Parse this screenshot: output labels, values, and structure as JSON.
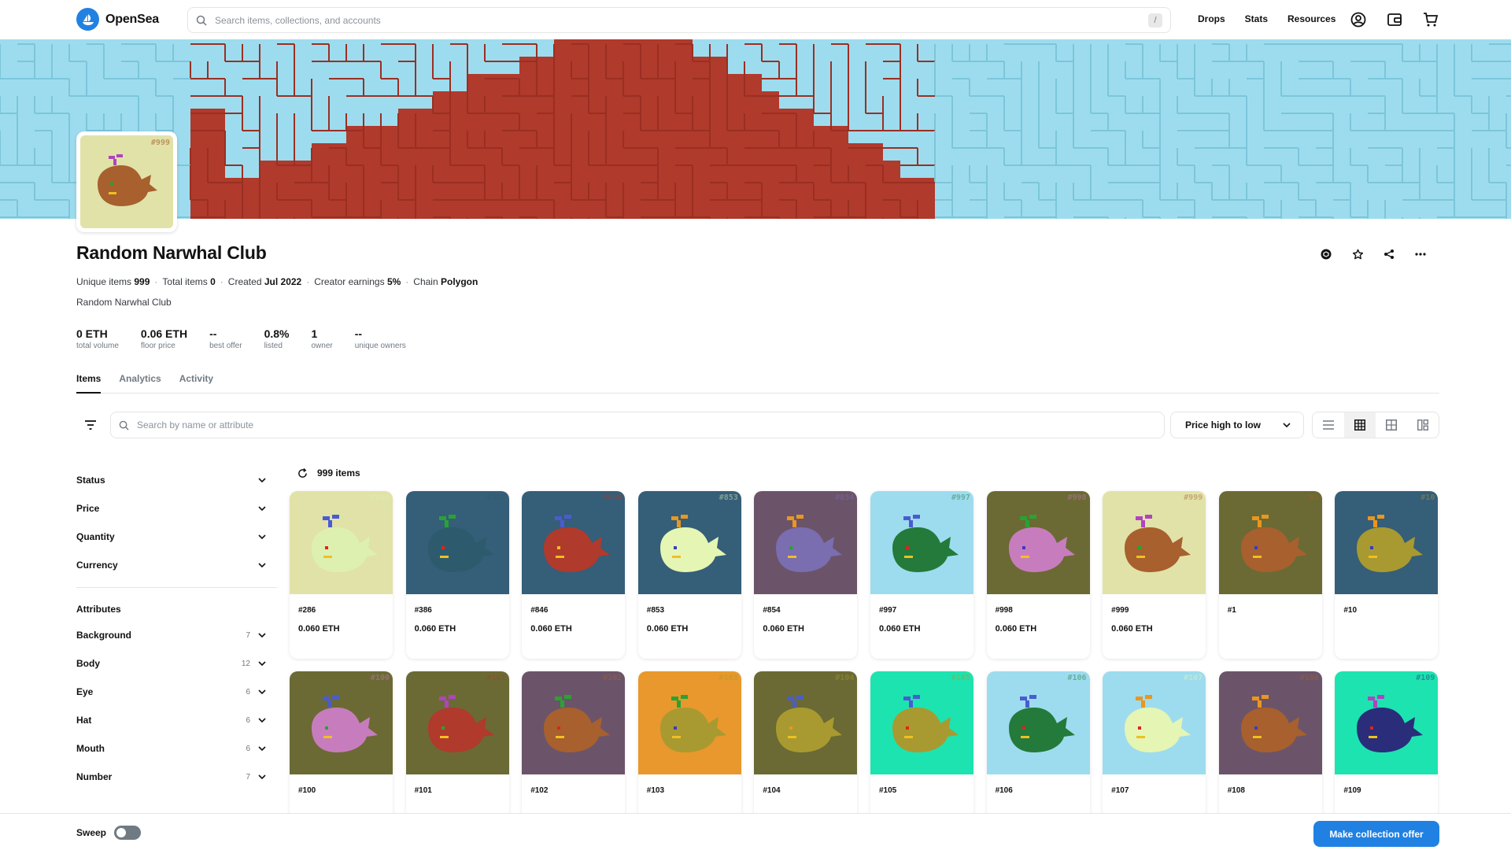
{
  "nav": {
    "brand": "OpenSea",
    "search_placeholder": "Search items, collections, and accounts",
    "search_shortcut": "/",
    "links": [
      "Drops",
      "Stats",
      "Resources"
    ]
  },
  "collection": {
    "title": "Random Narwhal Club",
    "meta": [
      {
        "label": "Unique items",
        "value": "999"
      },
      {
        "label": "Total items",
        "value": "0"
      },
      {
        "label": "Created",
        "value": "Jul 2022"
      },
      {
        "label": "Creator earnings",
        "value": "5%"
      },
      {
        "label": "Chain",
        "value": "Polygon"
      }
    ],
    "description": "Random Narwhal Club",
    "stats": [
      {
        "value": "0 ETH",
        "label": "total volume"
      },
      {
        "value": "0.06 ETH",
        "label": "floor price"
      },
      {
        "value": "--",
        "label": "best offer"
      },
      {
        "value": "0.8%",
        "label": "listed"
      },
      {
        "value": "1",
        "label": "owner"
      },
      {
        "value": "--",
        "label": "unique owners"
      }
    ]
  },
  "tabs": [
    "Items",
    "Analytics",
    "Activity"
  ],
  "toolbar": {
    "search_placeholder": "Search by name or attribute",
    "sort_label": "Price high to low"
  },
  "filters": {
    "groups": [
      "Status",
      "Price",
      "Quantity",
      "Currency"
    ],
    "attributes_title": "Attributes",
    "attributes": [
      {
        "name": "Background",
        "count": "7"
      },
      {
        "name": "Body",
        "count": "12"
      },
      {
        "name": "Eye",
        "count": "6"
      },
      {
        "name": "Hat",
        "count": "6"
      },
      {
        "name": "Mouth",
        "count": "6"
      },
      {
        "name": "Number",
        "count": "7"
      }
    ]
  },
  "results": {
    "count_label": "999 items"
  },
  "items": [
    {
      "name": "#286",
      "badge": "#286",
      "price": "0.060 ETH",
      "bg": "#e1e2a8",
      "body": "#ddf0b0",
      "hat": "#4a5bd1",
      "eye": "#e0241c"
    },
    {
      "name": "#386",
      "badge": "#386",
      "price": "0.060 ETH",
      "bg": "#355e78",
      "body": "#2d5b6d",
      "hat": "#28a332",
      "eye": "#e0241c"
    },
    {
      "name": "#846",
      "badge": "#846",
      "price": "0.060 ETH",
      "bg": "#355e78",
      "body": "#b03a2c",
      "hat": "#4a5bd1",
      "eye": "#f0c020"
    },
    {
      "name": "#853",
      "badge": "#853",
      "price": "0.060 ETH",
      "bg": "#355e78",
      "body": "#e5f5b3",
      "hat": "#e89720",
      "eye": "#3c3ac0"
    },
    {
      "name": "#854",
      "badge": "#854",
      "price": "0.060 ETH",
      "bg": "#6b5469",
      "body": "#7a6db0",
      "hat": "#e89720",
      "eye": "#28a332"
    },
    {
      "name": "#997",
      "badge": "#997",
      "price": "0.060 ETH",
      "bg": "#9ddcee",
      "body": "#237a3a",
      "hat": "#4a5bd1",
      "eye": "#e0241c"
    },
    {
      "name": "#998",
      "badge": "#998",
      "price": "0.060 ETH",
      "bg": "#6b6a34",
      "body": "#c77dbd",
      "hat": "#28a332",
      "eye": "#3c3ac0"
    },
    {
      "name": "#999",
      "badge": "#999",
      "price": "0.060 ETH",
      "bg": "#e1e2a8",
      "body": "#a7602e",
      "hat": "#b043c0",
      "eye": "#28a332"
    },
    {
      "name": "#1",
      "badge": "#1",
      "price": "",
      "bg": "#6b6a34",
      "body": "#a7602e",
      "hat": "#e89720",
      "eye": "#3c3ac0"
    },
    {
      "name": "#10",
      "badge": "#10",
      "price": "",
      "bg": "#355e78",
      "body": "#a89a30",
      "hat": "#e89720",
      "eye": "#3c3ac0"
    },
    {
      "name": "#100",
      "badge": "#100",
      "price": "",
      "bg": "#6b6a34",
      "body": "#c77dbd",
      "hat": "#4a5bd1",
      "eye": "#28a332"
    },
    {
      "name": "#101",
      "badge": "#101",
      "price": "",
      "bg": "#6b6a34",
      "body": "#b03a2c",
      "hat": "#b043c0",
      "eye": "#28a332"
    },
    {
      "name": "#102",
      "badge": "#102",
      "price": "",
      "bg": "#6b5469",
      "body": "#a7602e",
      "hat": "#28a332",
      "eye": "#e0241c"
    },
    {
      "name": "#103",
      "badge": "#103",
      "price": "",
      "bg": "#e8982c",
      "body": "#a89a30",
      "hat": "#28a332",
      "eye": "#3c3ac0"
    },
    {
      "name": "#104",
      "badge": "#104",
      "price": "",
      "bg": "#6b6a34",
      "body": "#a89a30",
      "hat": "#4a5bd1",
      "eye": "#e89720"
    },
    {
      "name": "#105",
      "badge": "#105",
      "price": "",
      "bg": "#1de3b0",
      "body": "#a89a30",
      "hat": "#4a5bd1",
      "eye": "#e0241c"
    },
    {
      "name": "#106",
      "badge": "#106",
      "price": "",
      "bg": "#9ddcee",
      "body": "#237a3a",
      "hat": "#4a5bd1",
      "eye": "#e0241c"
    },
    {
      "name": "#107",
      "badge": "#107",
      "price": "",
      "bg": "#9ddcee",
      "body": "#e5f5b3",
      "hat": "#e89720",
      "eye": "#e0241c"
    },
    {
      "name": "#108",
      "badge": "#108",
      "price": "",
      "bg": "#6b5469",
      "body": "#a7602e",
      "hat": "#e89720",
      "eye": "#3c3ac0"
    },
    {
      "name": "#109",
      "badge": "#109",
      "price": "",
      "bg": "#1de3b0",
      "body": "#2a2d7a",
      "hat": "#b043c0",
      "eye": "#e0241c"
    }
  ],
  "footer": {
    "sweep_label": "Sweep",
    "offer_button": "Make collection offer"
  },
  "colors": {
    "accent": "#2081e2",
    "banner_sky": "#9ddcee",
    "banner_red": "#b03a2c",
    "text_muted": "#707a83"
  },
  "icons": [
    "search-icon",
    "account-icon",
    "wallet-icon",
    "cart-icon",
    "polygon-icon",
    "star-icon",
    "share-icon",
    "more-icon",
    "filter-icon",
    "refresh-icon",
    "chevron-down-icon",
    "list-view-icon",
    "grid-view-icon",
    "large-grid-view-icon",
    "compact-grid-view-icon"
  ]
}
